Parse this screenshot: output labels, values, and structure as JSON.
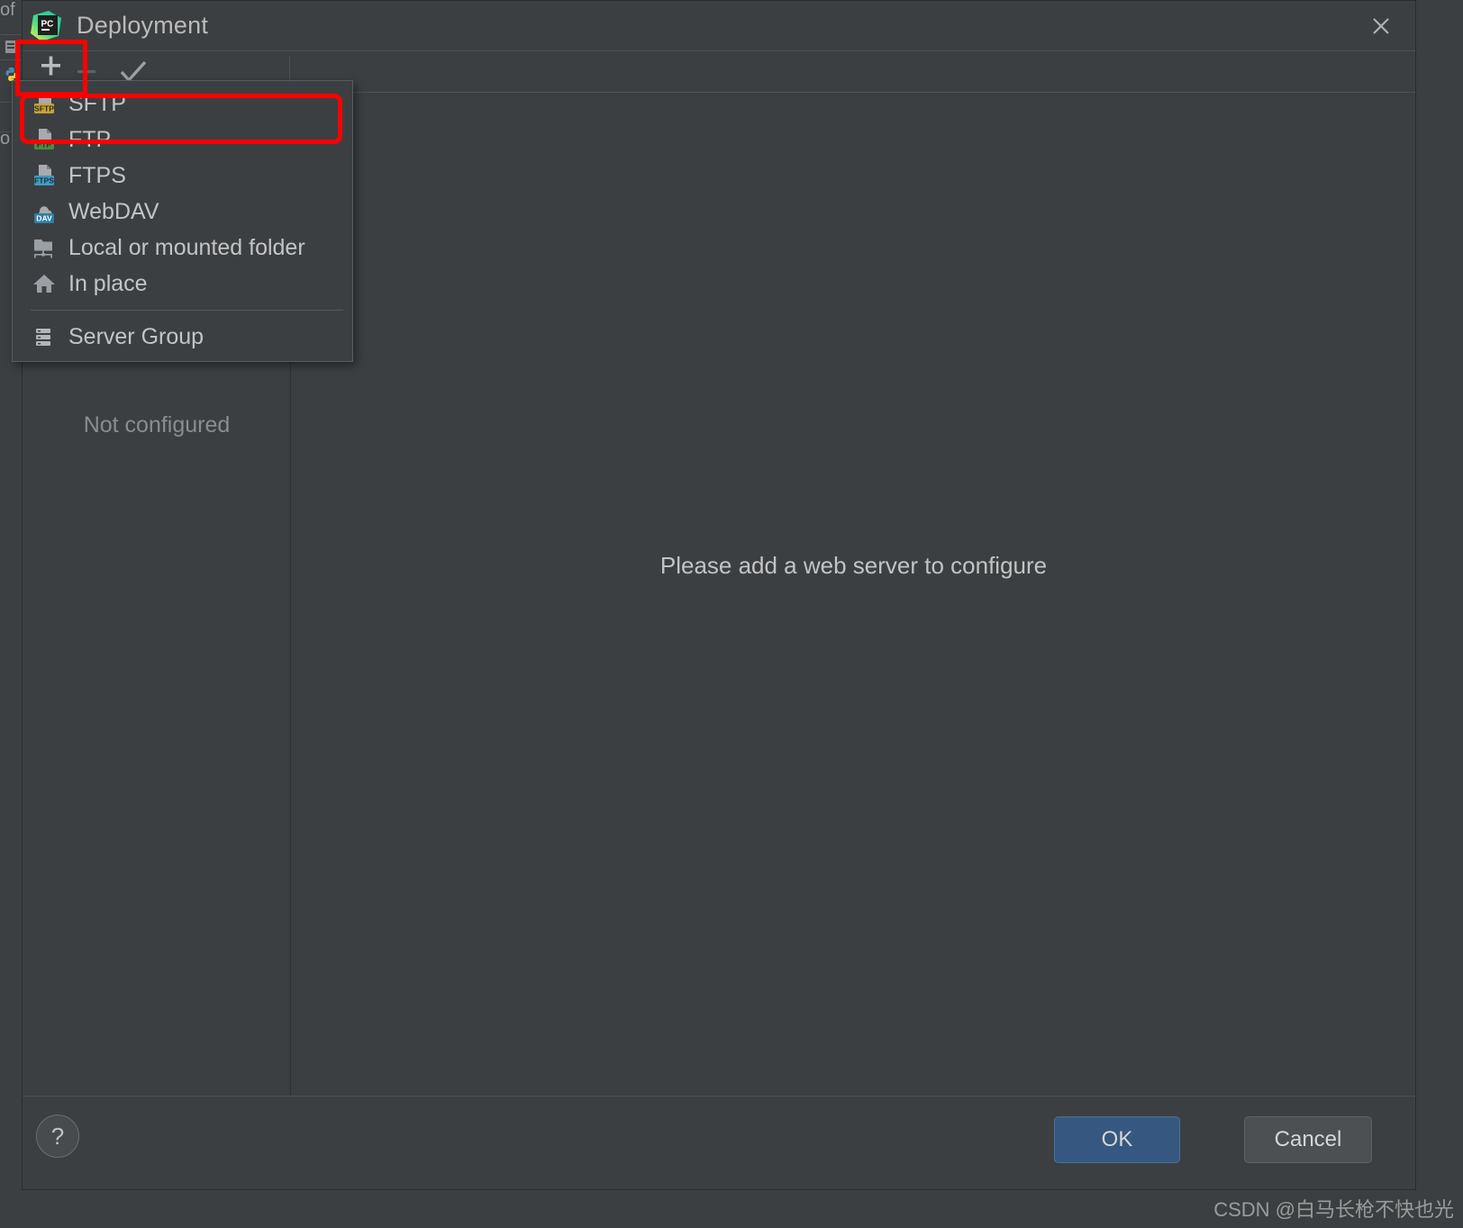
{
  "window": {
    "title": "Deployment",
    "app_icon": "pycharm-logo",
    "close_icon": "close-icon"
  },
  "toolbar": {
    "add_label": "+",
    "add_icon": "plus-icon",
    "remove_label": "–",
    "remove_icon": "minus-icon",
    "apply_icon": "checkmark-icon"
  },
  "popup_menu": {
    "items": [
      {
        "label": "SFTP",
        "icon": "sftp-server-icon",
        "badge": "SFTP",
        "badge_color": "#c9a135",
        "highlighted": true
      },
      {
        "label": "FTP",
        "icon": "ftp-server-icon",
        "badge": "FTP",
        "badge_color": "#4c8a3f",
        "highlighted": false
      },
      {
        "label": "FTPS",
        "icon": "ftps-server-icon",
        "badge": "FTPS",
        "badge_color": "#3b9dc4",
        "highlighted": false
      },
      {
        "label": "WebDAV",
        "icon": "webdav-cloud-icon",
        "badge": "DAV",
        "badge_color": "#2d7fa5",
        "highlighted": false
      },
      {
        "label": "Local or mounted folder",
        "icon": "network-folder-icon",
        "badge": "",
        "badge_color": "",
        "highlighted": false
      },
      {
        "label": "In place",
        "icon": "home-icon",
        "badge": "",
        "badge_color": "",
        "highlighted": false
      }
    ],
    "group_item": {
      "label": "Server Group",
      "icon": "server-stack-icon"
    }
  },
  "left_pane": {
    "empty_text": "Not configured"
  },
  "right_pane": {
    "empty_message": "Please add a web server to configure"
  },
  "footer": {
    "help_label": "?",
    "help_icon": "question-mark-icon",
    "ok_label": "OK",
    "cancel_label": "Cancel"
  },
  "ide_backdrop": {
    "text_top": "of",
    "text_bottom": "o"
  },
  "watermark": {
    "text": "CSDN @白马长枪不快也光"
  },
  "colors": {
    "dialog_bg": "#3c3f41",
    "accent_blue": "#365880",
    "annotation_red": "#fe0000",
    "text_primary": "#c3c4c5"
  }
}
